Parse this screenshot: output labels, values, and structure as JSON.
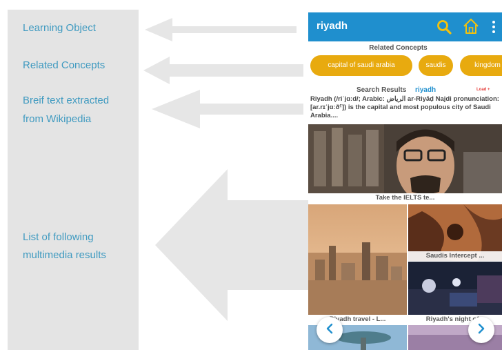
{
  "labels": {
    "learning_object": "Learning Object",
    "related_concepts": "Related Concepts",
    "brief_text_line1": "Breif text extracted",
    "brief_text_line2": "from Wikipedia",
    "multimedia_line1": "List of following",
    "multimedia_line2": "multimedia results"
  },
  "app": {
    "title": "riyadh",
    "related_heading": "Related Concepts",
    "chips": [
      "capital of saudi arabia",
      "saudis",
      "kingdom"
    ],
    "search_results_label": "Search Results",
    "search_query": "riyadh",
    "more_link": "Load +",
    "wiki_text": "Riyadh (/riˈjɑːd/; Arabic: الرياض‎ ar-Riyāḍ Najdi pronunciation: [ar.rɪˈjɑːðˤ]) is the capital and most populous city of Saudi Arabia....",
    "captions": {
      "video_1": "Take the IELTS te...",
      "video_2": "Saudis Intercept ...",
      "video_3": "Riyadh travel - L...",
      "video_4": "Riyadh's night of..."
    }
  },
  "colors": {
    "accent": "#1f8fce",
    "chip": "#e8aa0f",
    "label_text": "#3f9ac0",
    "panel": "#e4e4e4",
    "arrow": "#e4e4e4"
  },
  "icons": [
    "search-icon",
    "home-icon",
    "menu-icon",
    "chevron-left-icon",
    "chevron-right-icon"
  ]
}
